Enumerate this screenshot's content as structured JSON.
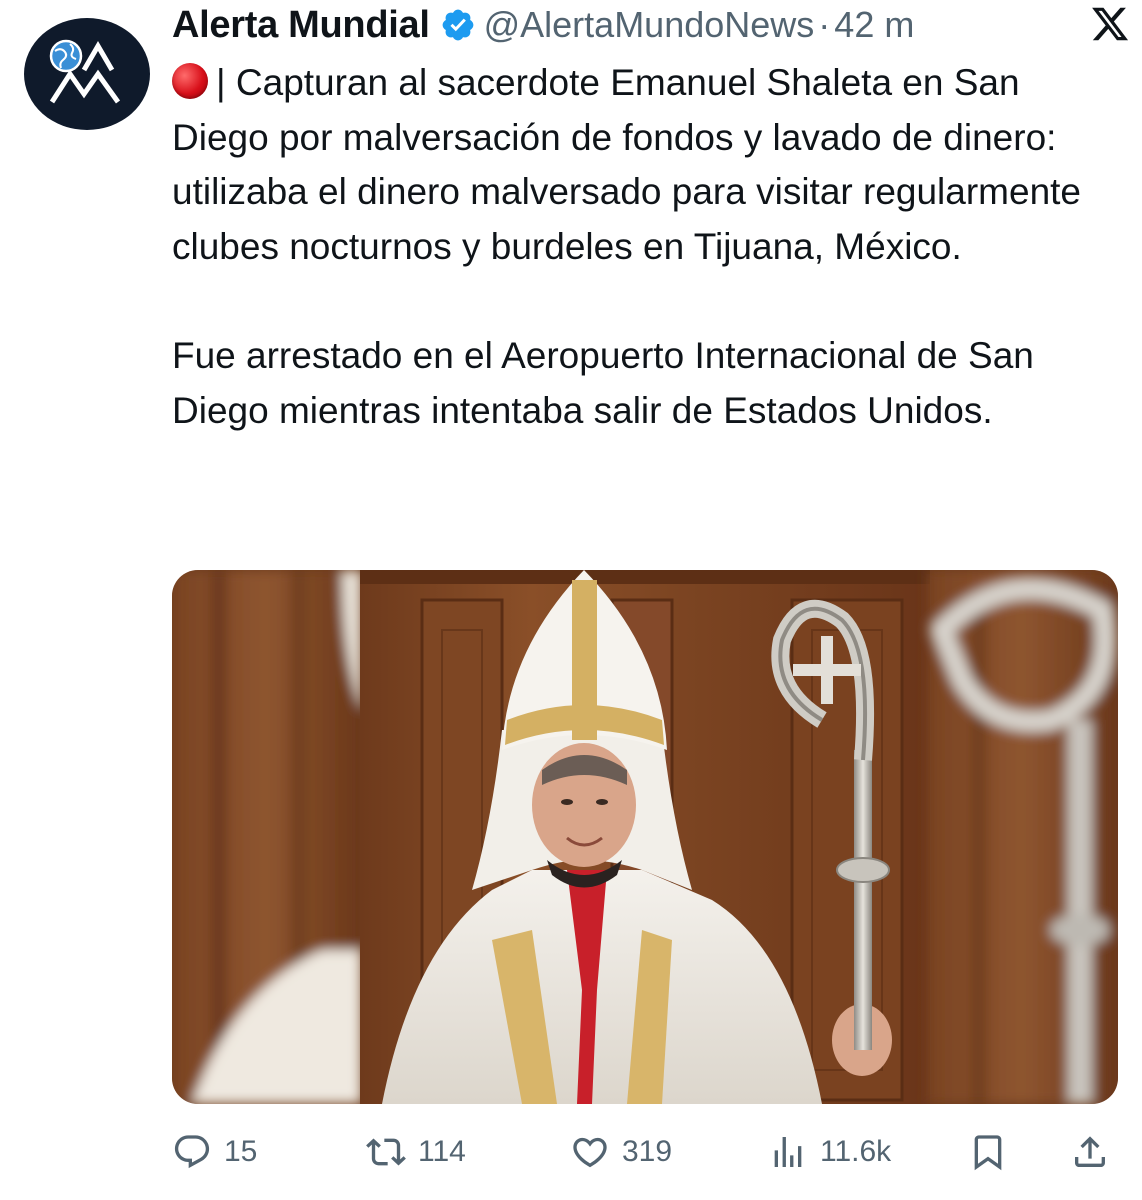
{
  "account": {
    "display_name": "Alerta Mundial",
    "handle": "@AlertaMundoNews",
    "separator": "·",
    "time_ago": "42 m",
    "avatar_icon": "globe-mountain-logo",
    "verified_color": "#1d9bf0"
  },
  "tweet": {
    "emoji": "red-circle-icon",
    "paragraph1": "| Capturan al sacerdote Emanuel Shaleta en San Diego por malversación de fondos y lavado de dinero: utilizaba el dinero malversado para visitar regularmente clubes nocturnos y burdeles en Tijuana, México.",
    "paragraph2": "Fue arrestado en el Aeropuerto Internacional de San Diego mientras intentaba salir de Estados Unidos."
  },
  "actions": {
    "replies": "15",
    "reposts": "114",
    "likes": "319",
    "views": "11.6k"
  },
  "colors": {
    "text": "#0f1419",
    "muted": "#536471",
    "accent": "#1d9bf0"
  }
}
